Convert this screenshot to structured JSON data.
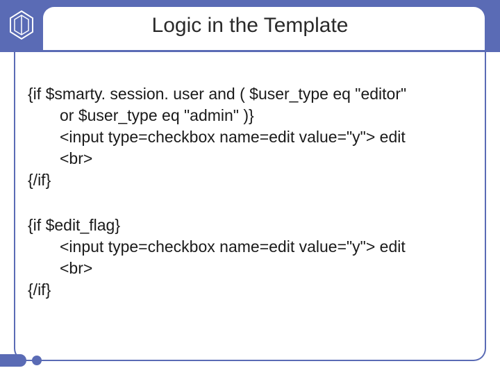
{
  "title": "Logic in the Template",
  "block1": {
    "line1": "{if $smarty. session. user and ( $user_type eq \"editor\"",
    "line2": "or $user_type eq \"admin\" )}",
    "line3": "<input type=checkbox name=edit value=\"y\"> edit",
    "line4": "<br>",
    "line5": "{/if}"
  },
  "block2": {
    "line1": "{if $edit_flag}",
    "line2": "<input type=checkbox name=edit value=\"y\"> edit",
    "line3": "<br>",
    "line4": "{/if}"
  }
}
